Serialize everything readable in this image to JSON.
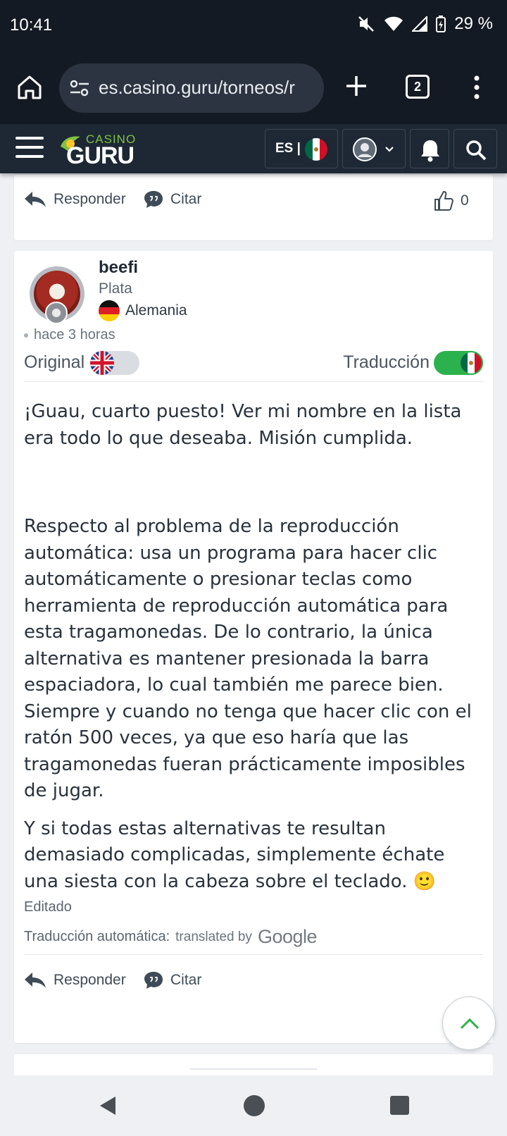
{
  "status_bar": {
    "time": "10:41",
    "battery": "29 %",
    "icons": [
      "mute-icon",
      "wifi-icon",
      "signal-icon",
      "battery-charging-icon"
    ]
  },
  "browser": {
    "url": "es.casino.guru/torneos/r",
    "tab_count": "2"
  },
  "site_header": {
    "logo_top": "CASINO",
    "logo_bottom": "GURU",
    "language": "ES |"
  },
  "prev_post": {
    "reply_label": "Responder",
    "quote_label": "Citar",
    "likes": "0"
  },
  "post": {
    "username": "beefi",
    "rank": "Plata",
    "country": "Alemania",
    "time_ago": "hace 3 horas",
    "original_label": "Original",
    "translation_label": "Traducción",
    "paragraphs": [
      "¡Guau, cuarto puesto! Ver mi nombre en la lista era todo lo que deseaba. Misión cumplida.",
      "Respecto al problema de la reproducción automática: usa un programa para hacer clic automáticamente o presionar teclas como herramienta de reproducción automática para esta tragamonedas. De lo contrario, la única alternativa es mantener presionada la barra espaciadora, lo cual también me parece bien. Siempre y cuando no tenga que hacer clic con el ratón 500 veces, ya que eso haría que las tragamonedas fueran prácticamente imposibles de jugar.",
      "Y si todas estas alternativas te resultan demasiado complicadas, simplemente échate una siesta con la cabeza sobre el teclado. 🙂"
    ],
    "edited_label": "Editado",
    "auto_translation_label": "Traducción automática:",
    "translated_by": "translated by",
    "google": "Google",
    "reply_label": "Responder",
    "quote_label": "Citar"
  },
  "colors": {
    "status_bg": "#141a23",
    "header_bg": "#1d2834",
    "toggle_on": "#2bb24c",
    "logo_green": "#7fc142"
  }
}
